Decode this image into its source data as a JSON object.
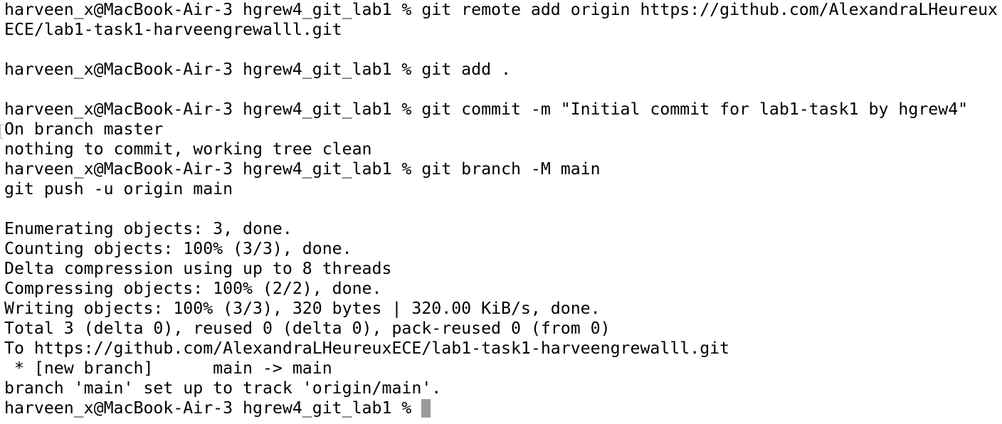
{
  "terminal": {
    "lines": [
      "harveen_x@MacBook-Air-3 hgrew4_git_lab1 % git remote add origin https://github.com/AlexandraLHeureux",
      "ECE/lab1-task1-harveengrewalll.git",
      "",
      "harveen_x@MacBook-Air-3 hgrew4_git_lab1 % git add .",
      "",
      "harveen_x@MacBook-Air-3 hgrew4_git_lab1 % git commit -m \"Initial commit for lab1-task1 by hgrew4\"",
      "On branch master",
      "nothing to commit, working tree clean",
      "harveen_x@MacBook-Air-3 hgrew4_git_lab1 % git branch -M main",
      "git push -u origin main",
      "",
      "Enumerating objects: 3, done.",
      "Counting objects: 100% (3/3), done.",
      "Delta compression using up to 8 threads",
      "Compressing objects: 100% (2/2), done.",
      "Writing objects: 100% (3/3), 320 bytes | 320.00 KiB/s, done.",
      "Total 3 (delta 0), reused 0 (delta 0), pack-reused 0 (from 0)",
      "To https://github.com/AlexandraLHeureuxECE/lab1-task1-harveengrewalll.git",
      " * [new branch]      main -> main",
      "branch 'main' set up to track 'origin/main'."
    ],
    "prompt": "harveen_x@MacBook-Air-3 hgrew4_git_lab1 % ",
    "cursor_color": "#9a9a9a"
  }
}
